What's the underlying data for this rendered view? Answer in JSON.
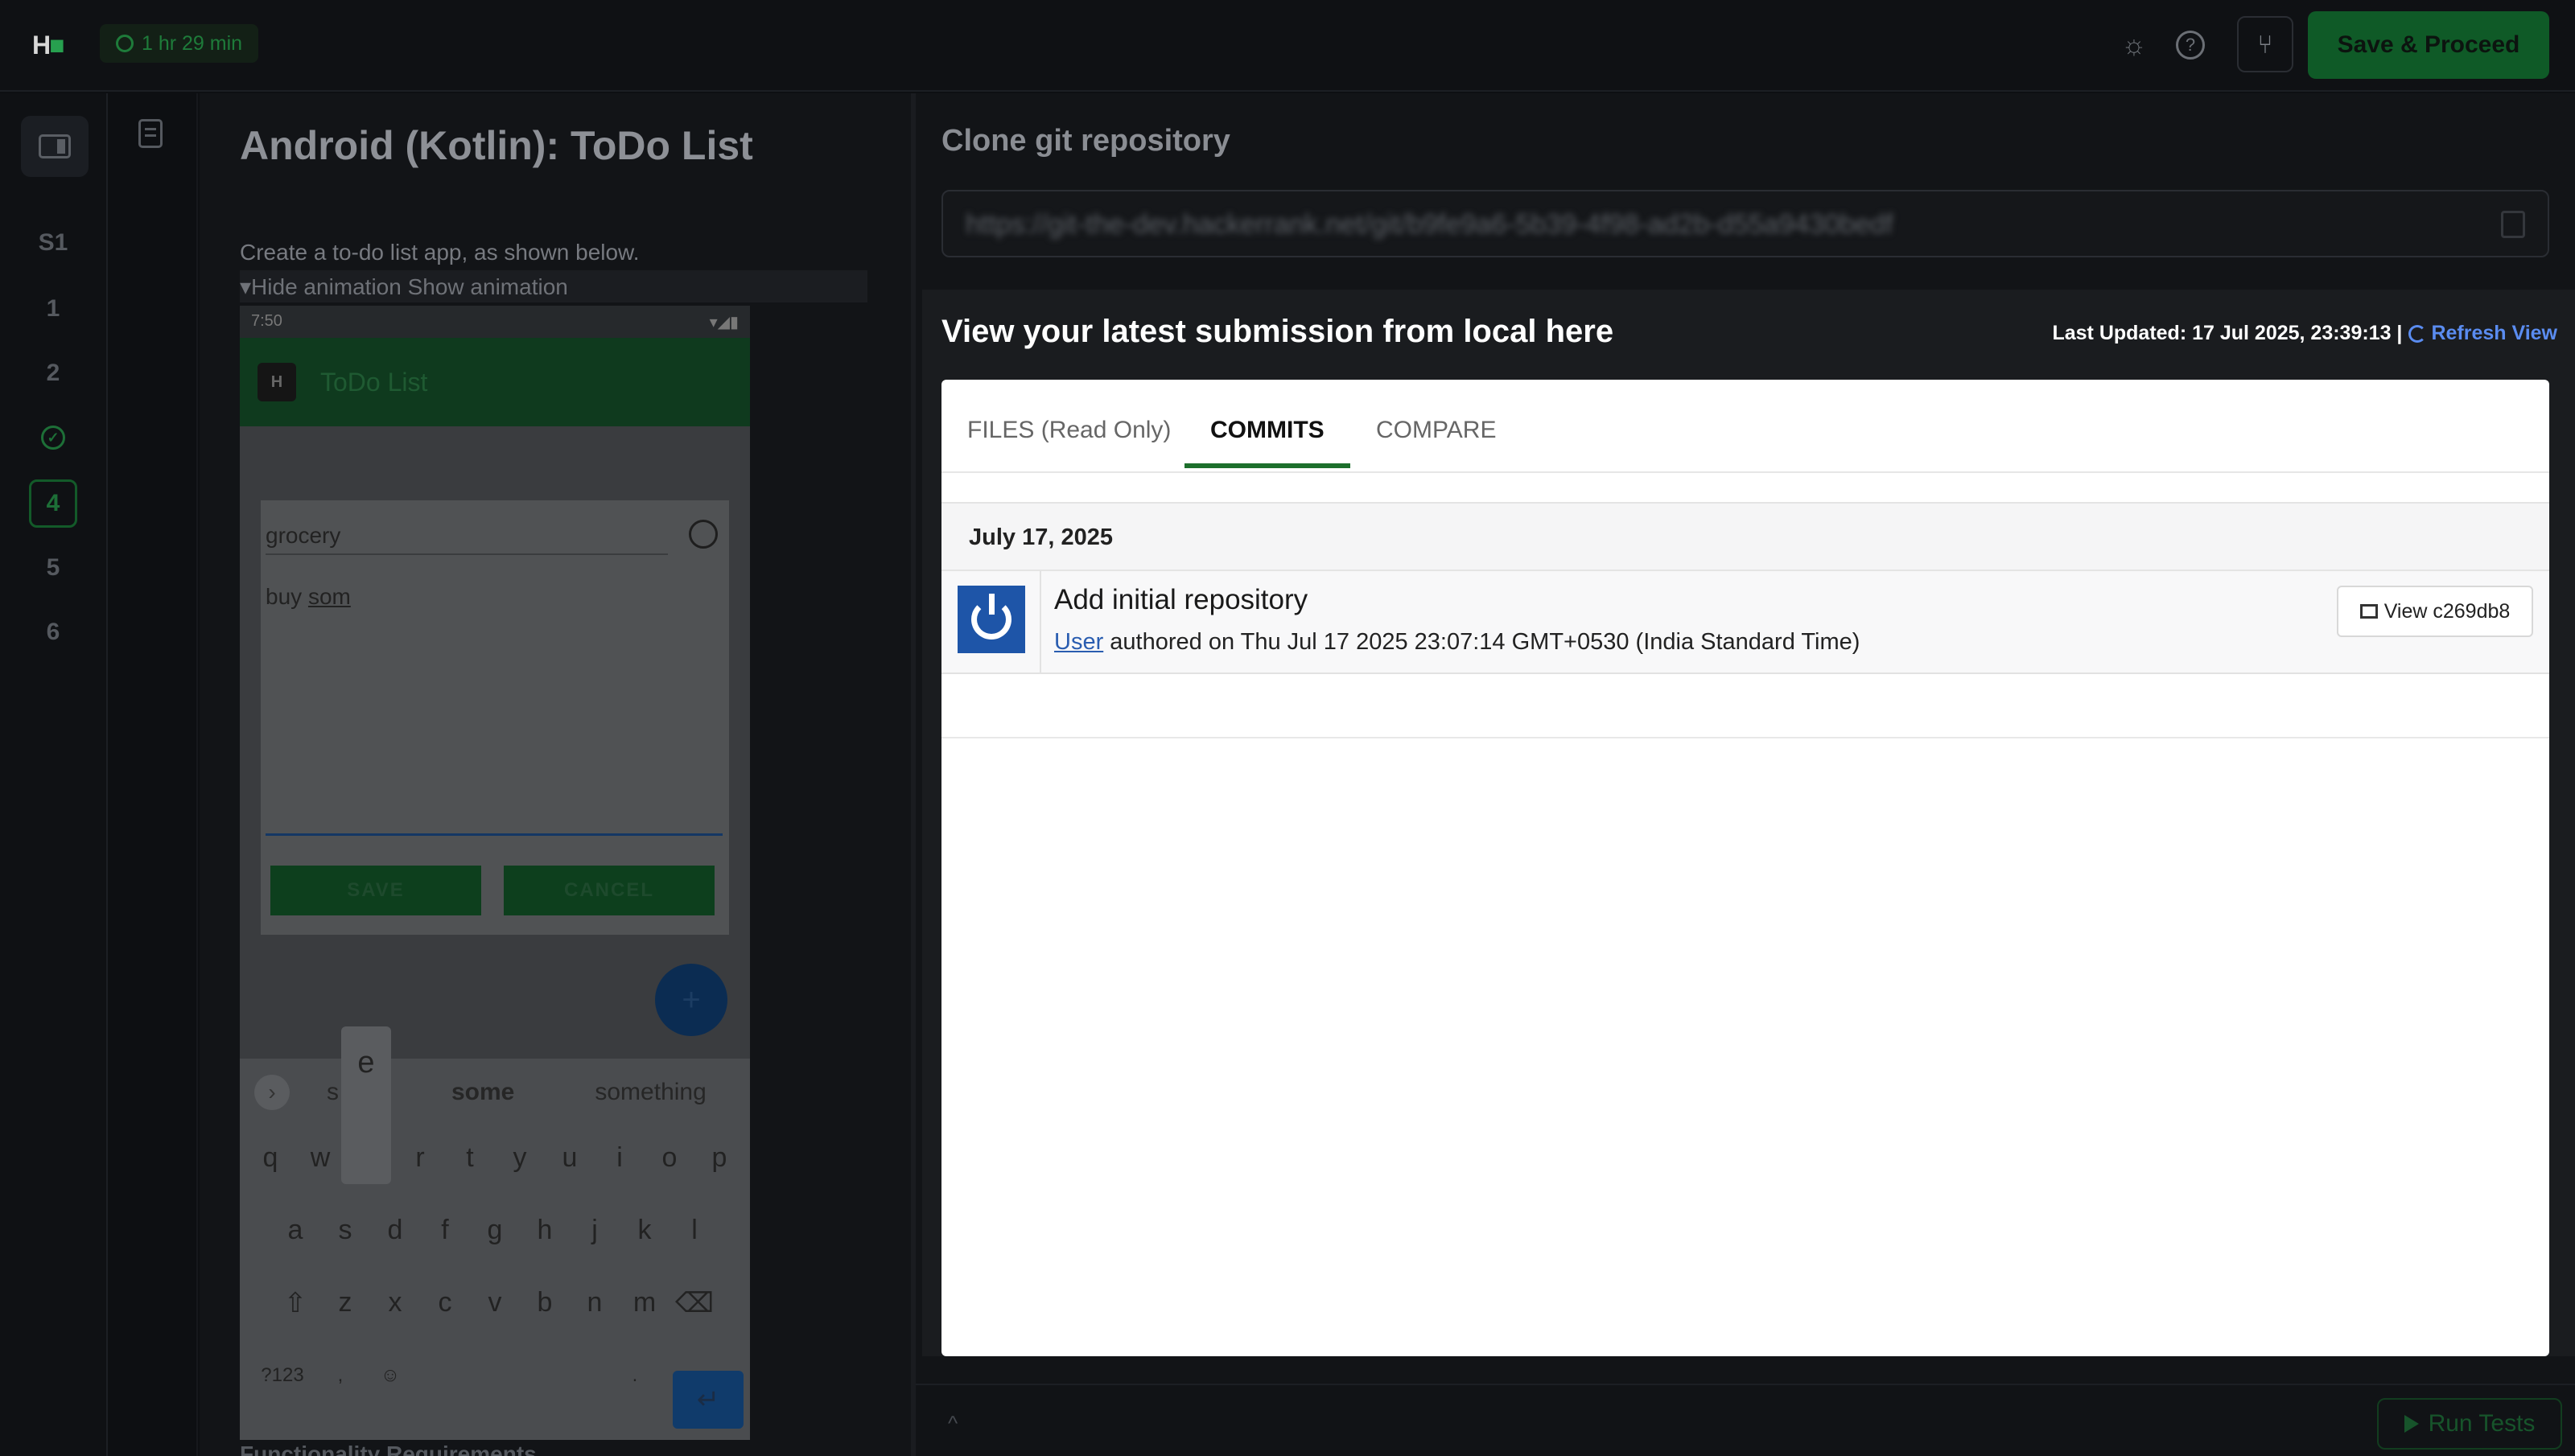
{
  "topbar": {
    "logo_mark": "H",
    "timer": "1 hr 29 min",
    "save_proceed_label": "Save & Proceed",
    "icons": [
      "sun-icon",
      "help-icon",
      "git-branch-icon"
    ]
  },
  "rail": {
    "items": [
      {
        "label": "S1",
        "state": "default"
      },
      {
        "label": "1",
        "state": "default"
      },
      {
        "label": "2",
        "state": "default"
      },
      {
        "label": "✓",
        "state": "done"
      },
      {
        "label": "4",
        "state": "active"
      },
      {
        "label": "5",
        "state": "default"
      },
      {
        "label": "6",
        "state": "default"
      }
    ]
  },
  "problem": {
    "title": "Android (Kotlin): ToDo List",
    "description": "Create a to-do list app, as shown below.",
    "animation_toggle": "▾Hide animation Show animation",
    "functionality_heading": "Functionality Requirements"
  },
  "phone": {
    "time": "7:50",
    "app_title": "ToDo List",
    "title_field": "grocery",
    "body_field_prefix": "buy ",
    "body_field_word": "som",
    "save_label": "SAVE",
    "cancel_label": "CANCEL",
    "fab": "+",
    "suggestions": [
      "s",
      "some",
      "something"
    ],
    "keypop": "e",
    "row1": [
      "q",
      "w",
      "e",
      "r",
      "t",
      "y",
      "u",
      "i",
      "o",
      "p"
    ],
    "row2": [
      "a",
      "s",
      "d",
      "f",
      "g",
      "h",
      "j",
      "k",
      "l"
    ],
    "row3": [
      "⇧",
      "z",
      "x",
      "c",
      "v",
      "b",
      "n",
      "m",
      "⌫"
    ],
    "row4": [
      "?123",
      ",",
      "☺",
      "",
      "."
    ]
  },
  "clone": {
    "title": "Clone git repository",
    "url": "https://git-the-dev.hackerrank.net/git/b9fe9a6-5b39-4f98-ad2b-d55a9430bedf"
  },
  "submission": {
    "title": "View your latest submission from local here",
    "last_updated": "Last Updated: 17 Jul 2025, 23:39:13 |",
    "refresh_label": "Refresh View",
    "tabs": [
      {
        "label": "FILES (Read Only)",
        "active": false
      },
      {
        "label": "COMMITS",
        "active": true
      },
      {
        "label": "COMPARE",
        "active": false
      }
    ],
    "commit_date": "July 17, 2025",
    "commit": {
      "message": "Add initial repository",
      "author": "User",
      "meta": " authored on Thu Jul 17 2025 23:07:14 GMT+0530 (India Standard Time)",
      "view_label": "View c269db8"
    }
  },
  "footer": {
    "chevron": "^",
    "run_tests_label": "Run Tests"
  },
  "colors": {
    "accent_green": "#0f5a27",
    "link_blue": "#5a8cf0",
    "tab_underline": "#1d6f2c",
    "avatar_blue": "#1e55a8"
  }
}
